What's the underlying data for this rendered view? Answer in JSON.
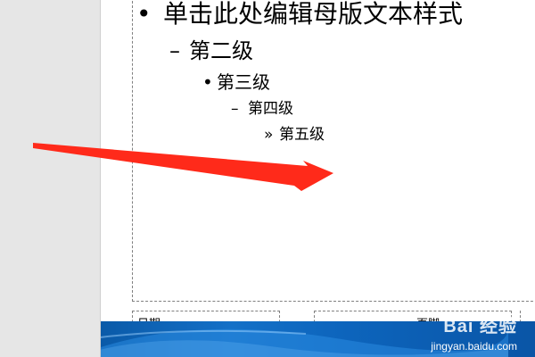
{
  "slide_master": {
    "body_levels": [
      {
        "bullet": "•",
        "text": "单击此处编辑母版文本样式"
      },
      {
        "bullet": "–",
        "text": "第二级"
      },
      {
        "bullet": "•",
        "text": "第三级"
      },
      {
        "bullet": "–",
        "text": "第四级"
      },
      {
        "bullet": "»",
        "text": "第五级"
      }
    ],
    "footer": {
      "date_label": "日期",
      "number_label": "页脚"
    }
  },
  "watermark": {
    "logo": "Bai 经验",
    "url": "jingyan.baidu.com"
  },
  "colors": {
    "arrow": "#ff2a1a",
    "band": "#0d65bd",
    "workspace": "#e6e6e6"
  }
}
